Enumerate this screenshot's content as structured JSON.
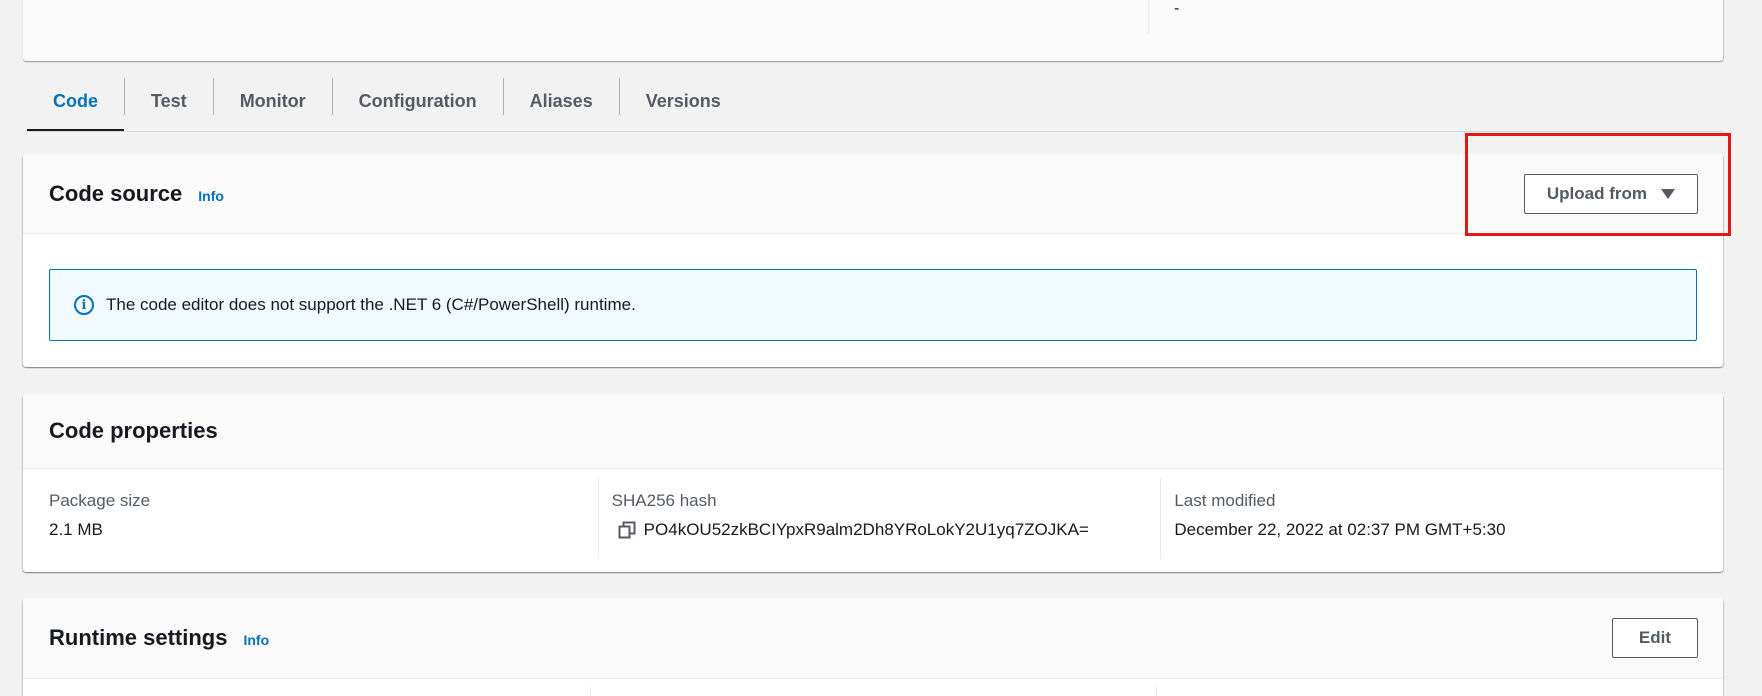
{
  "top_panel": {
    "value": "-"
  },
  "tabs": [
    {
      "label": "Code",
      "active": true
    },
    {
      "label": "Test",
      "active": false
    },
    {
      "label": "Monitor",
      "active": false
    },
    {
      "label": "Configuration",
      "active": false
    },
    {
      "label": "Aliases",
      "active": false
    },
    {
      "label": "Versions",
      "active": false
    }
  ],
  "code_source": {
    "title": "Code source",
    "info": "Info",
    "upload_button": "Upload from",
    "alert_text": "The code editor does not support the .NET 6 (C#/PowerShell) runtime."
  },
  "code_properties": {
    "title": "Code properties",
    "package_size": {
      "label": "Package size",
      "value": "2.1 MB"
    },
    "sha256": {
      "label": "SHA256 hash",
      "value": "PO4kOU52zkBCIYpxR9alm2Dh8YRoLokY2U1yq7ZOJKA="
    },
    "last_modified": {
      "label": "Last modified",
      "value": "December 22, 2022 at 02:37 PM GMT+5:30"
    }
  },
  "runtime_settings": {
    "title": "Runtime settings",
    "info": "Info",
    "edit_button": "Edit"
  },
  "colors": {
    "accent_blue": "#0073bb",
    "highlight_red": "#e5161a",
    "alert_bg": "#f1faff"
  },
  "icons": {
    "alert": "info-circle-icon",
    "dropdown": "caret-down-icon",
    "copy": "copy-icon"
  }
}
